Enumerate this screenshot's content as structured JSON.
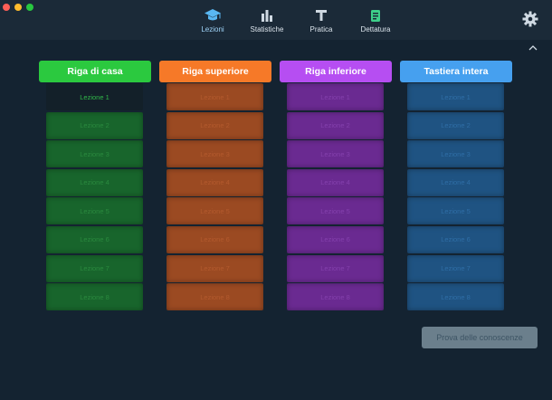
{
  "nav": [
    {
      "label": "Lezioni",
      "icon": "graduation-cap-icon",
      "active": true
    },
    {
      "label": "Statistiche",
      "icon": "bar-chart-icon",
      "active": false
    },
    {
      "label": "Pratica",
      "icon": "text-t-icon",
      "active": false
    },
    {
      "label": "Dettatura",
      "icon": "document-icon",
      "active": false
    }
  ],
  "columns": [
    {
      "title": "Riga di casa",
      "color": "#2bc93f",
      "lessons": [
        "Lezione 1",
        "Lezione 2",
        "Lezione 3",
        "Lezione 4",
        "Lezione 5",
        "Lezione 6",
        "Lezione 7",
        "Lezione 8"
      ]
    },
    {
      "title": "Riga superiore",
      "color": "#f67928",
      "lessons": [
        "Lezione 1",
        "Lezione 2",
        "Lezione 3",
        "Lezione 4",
        "Lezione 5",
        "Lezione 6",
        "Lezione 7",
        "Lezione 8"
      ]
    },
    {
      "title": "Riga inferiore",
      "color": "#b64ef2",
      "lessons": [
        "Lezione 1",
        "Lezione 2",
        "Lezione 3",
        "Lezione 4",
        "Lezione 5",
        "Lezione 6",
        "Lezione 7",
        "Lezione 8"
      ]
    },
    {
      "title": "Tastiera intera",
      "color": "#46a0ef",
      "lessons": [
        "Lezione 1",
        "Lezione 2",
        "Lezione 3",
        "Lezione 4",
        "Lezione 5",
        "Lezione 6",
        "Lezione 7",
        "Lezione 8"
      ]
    }
  ],
  "test_button": "Prova delle conoscenze"
}
